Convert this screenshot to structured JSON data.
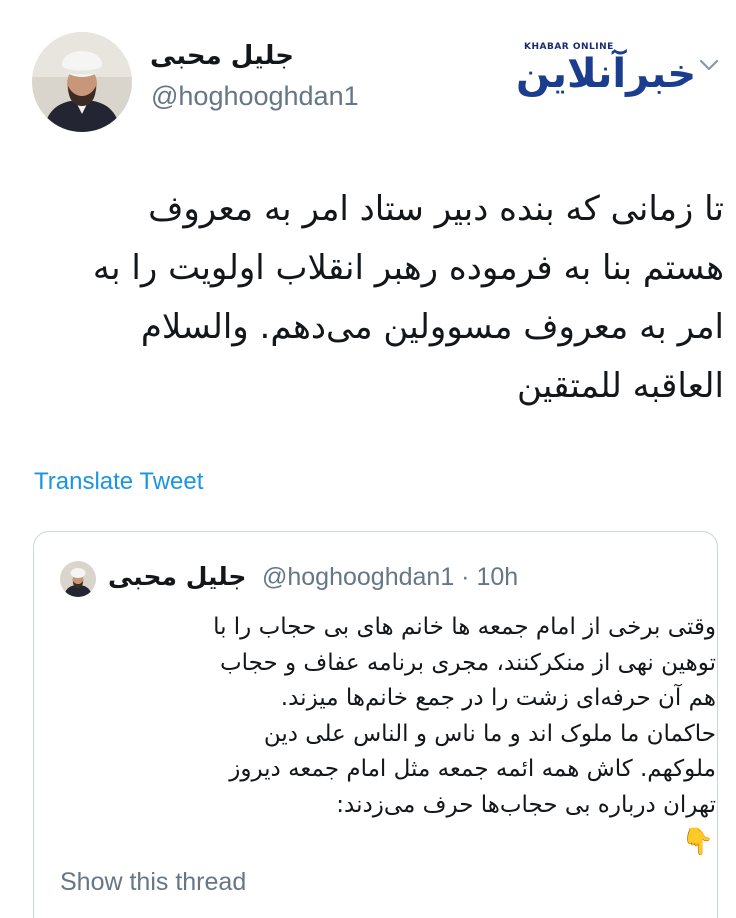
{
  "tweet": {
    "author_name": "جلیل محبی",
    "author_handle": "@hoghooghdan1",
    "lines": [
      "تا زمانی که بنده دبیر ستاد امر به معروف",
      "هستم بنا به فرموده رهبر انقلاب اولویت را به",
      "امر به معروف مسوولین می‌دهم. والسلام",
      "العاقبه للمتقین"
    ],
    "translate_label": "Translate Tweet"
  },
  "watermark": {
    "english": "KHABAR ONLINE",
    "persian": "خبرآنلاین"
  },
  "quoted": {
    "author_name": "جلیل محبی",
    "author_handle_time": "@hoghooghdan1 · 10h",
    "lines": [
      "وقتی برخی از امام جمعه ها خانم های بی حجاب را با",
      "توهین نهی از منکرکنند، مجری برنامه عفاف و حجاب",
      "هم آن حرفه‌ای زشت را در جمع خانم‌ها میزند.",
      "حاکمان ما ملوک اند و ما ناس و الناس علی دین",
      "ملوکهم. کاش همه ائمه جمعه مثل امام جمعه دیروز",
      "تهران درباره بی حجاب‌ها حرف می‌زدند:"
    ],
    "emoji": "👇",
    "show_thread_label": "Show this thread"
  },
  "icons": {
    "menu": "chevron-down-icon"
  }
}
